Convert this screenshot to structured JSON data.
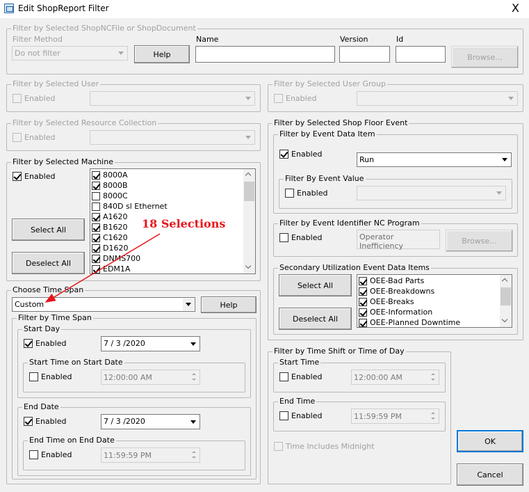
{
  "window": {
    "title": "Edit ShopReport Filter",
    "close": "X"
  },
  "ncfile": {
    "legend": "Filter by Selected ShopNCFile or ShopDocument",
    "method_label": "Filter Method",
    "method_value": "Do not filter",
    "help": "Help",
    "name_label": "Name",
    "version_label": "Version",
    "id_label": "Id",
    "browse": "Browse..."
  },
  "user": {
    "legend": "Filter by Selected User",
    "enabled": "Enabled"
  },
  "usergroup": {
    "legend": "Filter by Selected User Group",
    "enabled": "Enabled"
  },
  "resource": {
    "legend": "Filter by Selected Resource Collection",
    "enabled": "Enabled"
  },
  "machine": {
    "legend": "Filter by Selected Machine",
    "enabled": "Enabled",
    "select_all": "Select All",
    "deselect_all": "Deselect All",
    "items": [
      {
        "label": "8000A",
        "checked": true
      },
      {
        "label": "8000B",
        "checked": true
      },
      {
        "label": "8000C",
        "checked": false
      },
      {
        "label": "840D sl Ethernet",
        "checked": false
      },
      {
        "label": "A1620",
        "checked": true
      },
      {
        "label": "B1620",
        "checked": true
      },
      {
        "label": "C1620",
        "checked": true
      },
      {
        "label": "D1620",
        "checked": true
      },
      {
        "label": "DNMS700",
        "checked": true
      },
      {
        "label": "EDM1A",
        "checked": true
      }
    ]
  },
  "annotation": "18 Selections",
  "timespan": {
    "legend": "Choose Time Span",
    "value": "Custom",
    "help": "Help",
    "filter_legend": "Filter by Time Span",
    "start_day": "Start Day",
    "enabled": "Enabled",
    "start_date": "7 / 3 /2020",
    "start_time_legend": "Start Time on Start Date",
    "start_time": "12:00:00 AM",
    "end_date_legend": "End Date",
    "end_date": "7 / 3 /2020",
    "end_time_legend": "End Time on End Date",
    "end_time": "11:59:59 PM"
  },
  "event": {
    "legend": "Filter by Selected Shop Floor Event",
    "data_item_legend": "Filter by Event Data Item",
    "enabled": "Enabled",
    "data_item_value": "Run",
    "value_legend": "Filter By Event Value",
    "nc_legend": "Filter by Event Identifier NC Program",
    "nc_value": "Operator Inefficiency",
    "browse": "Browse..."
  },
  "secondary": {
    "legend": "Secondary Utilization Event Data Items",
    "select_all": "Select All",
    "deselect_all": "Deselect All",
    "items": [
      {
        "label": "OEE-Bad Parts",
        "checked": true
      },
      {
        "label": "OEE-Breakdowns",
        "checked": true
      },
      {
        "label": "OEE-Breaks",
        "checked": true
      },
      {
        "label": "OEE-Information",
        "checked": true
      },
      {
        "label": "OEE-Planned Downtime",
        "checked": true
      }
    ]
  },
  "shift": {
    "legend": "Filter by Time Shift or Time of Day",
    "start_time": "Start Time",
    "enabled": "Enabled",
    "start_value": "12:00:00 AM",
    "end_time": "End Time",
    "end_value": "11:59:59 PM",
    "midnight": "Time Includes Midnight"
  },
  "buttons": {
    "ok": "OK",
    "cancel": "Cancel"
  }
}
